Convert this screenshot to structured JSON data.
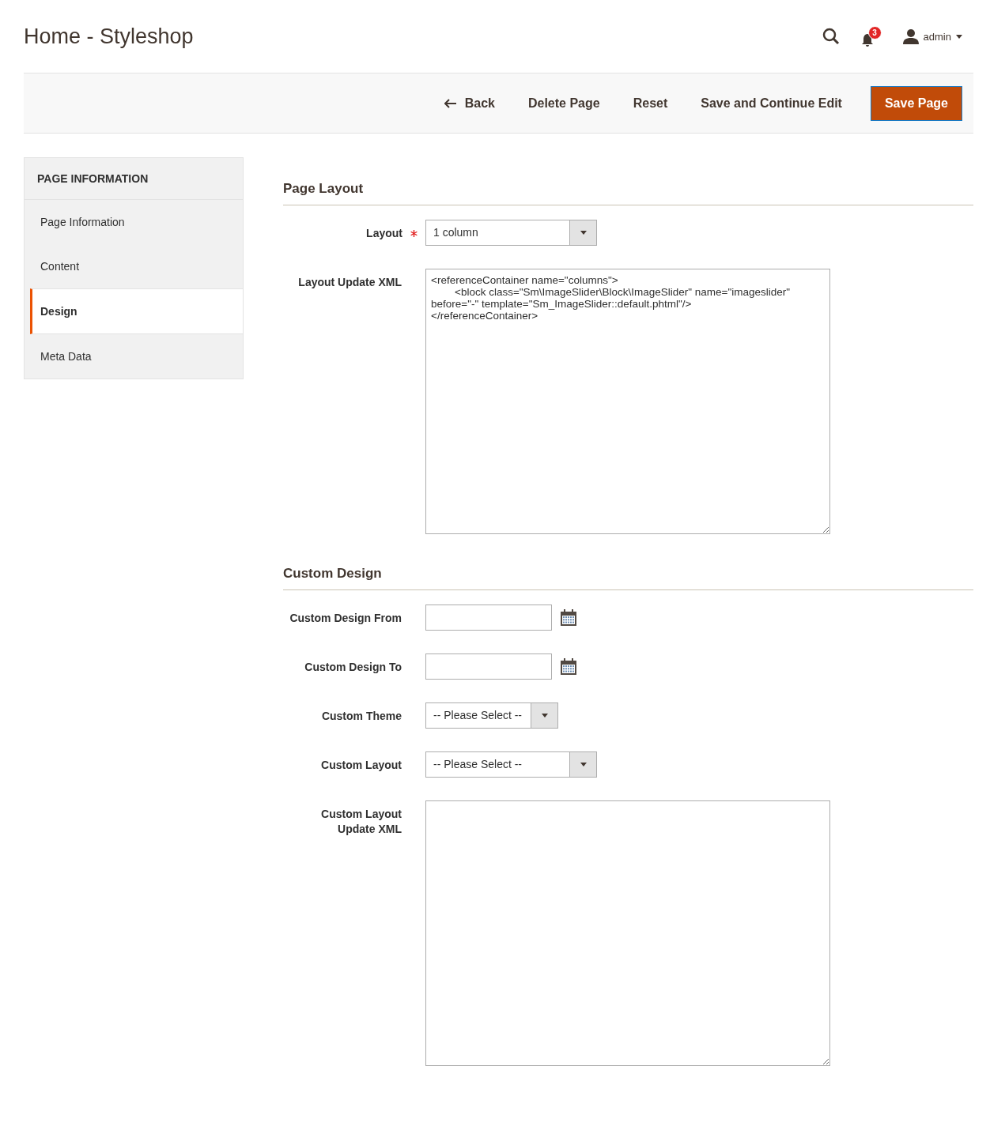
{
  "header": {
    "title": "Home - Styleshop",
    "notifications": {
      "count": "3"
    },
    "user": {
      "name": "admin"
    }
  },
  "actions": [
    {
      "kind": "back",
      "label": "Back"
    },
    {
      "kind": "plain",
      "label": "Delete Page"
    },
    {
      "kind": "plain",
      "label": "Reset"
    },
    {
      "kind": "plain",
      "label": "Save and Continue Edit"
    },
    {
      "kind": "primary",
      "label": "Save Page"
    }
  ],
  "sidebar": {
    "title": "PAGE INFORMATION",
    "items": [
      {
        "label": "Page Information",
        "selected": false
      },
      {
        "label": "Content",
        "selected": false
      },
      {
        "label": "Design",
        "selected": true
      },
      {
        "label": "Meta Data",
        "selected": false
      }
    ]
  },
  "sections": [
    {
      "title": "Page Layout",
      "fields": [
        {
          "kind": "select",
          "label": "Layout",
          "required": true,
          "value": "1 column"
        },
        {
          "kind": "textarea",
          "label": "Layout Update XML",
          "required": false,
          "value": "<referenceContainer name=\"columns\">\n        <block class=\"Sm\\ImageSlider\\Block\\ImageSlider\" name=\"imageslider\" before=\"-\" template=\"Sm_ImageSlider::default.phtml\"/>\n</referenceContainer>"
        }
      ]
    },
    {
      "title": "Custom Design",
      "fields": [
        {
          "kind": "date",
          "label": "Custom Design From",
          "required": false
        },
        {
          "kind": "date",
          "label": "Custom Design To",
          "required": false
        },
        {
          "kind": "short-select",
          "label": "Custom Theme",
          "required": false,
          "value": "-- Please Select --"
        },
        {
          "kind": "select",
          "label": "Custom Layout",
          "required": false,
          "value": "-- Please Select --"
        },
        {
          "kind": "textarea",
          "label": "Custom Layout Update XML",
          "required": false
        }
      ]
    }
  ]
}
